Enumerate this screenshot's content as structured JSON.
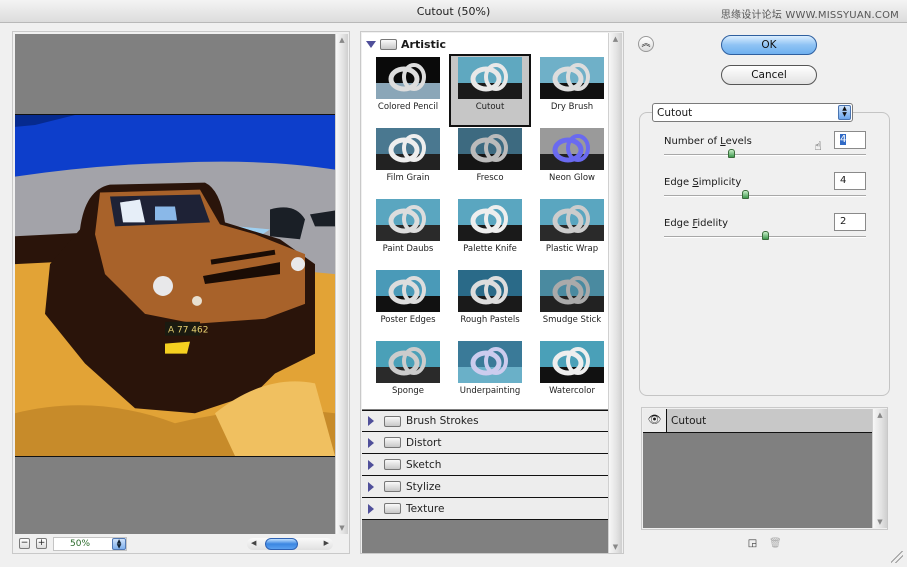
{
  "window": {
    "title": "Cutout (50%)",
    "watermark": "思缘设计论坛 WWW.MISSYUAN.COM"
  },
  "preview": {
    "zoom_out_label": "−",
    "zoom_in_label": "+",
    "zoom_value": "50%",
    "license_plate": "A 77 462"
  },
  "filter_gallery": {
    "open_category": "Artistic",
    "filters": [
      {
        "label": "Colored Pencil",
        "selected": false
      },
      {
        "label": "Cutout",
        "selected": true
      },
      {
        "label": "Dry Brush",
        "selected": false
      },
      {
        "label": "Film Grain",
        "selected": false
      },
      {
        "label": "Fresco",
        "selected": false
      },
      {
        "label": "Neon Glow",
        "selected": false
      },
      {
        "label": "Paint Daubs",
        "selected": false
      },
      {
        "label": "Palette Knife",
        "selected": false
      },
      {
        "label": "Plastic Wrap",
        "selected": false
      },
      {
        "label": "Poster Edges",
        "selected": false
      },
      {
        "label": "Rough Pastels",
        "selected": false
      },
      {
        "label": "Smudge Stick",
        "selected": false
      },
      {
        "label": "Sponge",
        "selected": false
      },
      {
        "label": "Underpainting",
        "selected": false
      },
      {
        "label": "Watercolor",
        "selected": false
      }
    ],
    "collapsed_categories": [
      "Brush Strokes",
      "Distort",
      "Sketch",
      "Stylize",
      "Texture"
    ]
  },
  "actions": {
    "ok_label": "OK",
    "cancel_label": "Cancel",
    "collapse_icon": "double-chevron-up"
  },
  "settings": {
    "selected_filter": "Cutout",
    "params": [
      {
        "label_pre": "Number of ",
        "label_key": "L",
        "label_post": "evels",
        "value": "4",
        "slider_fraction": 0.33,
        "focused": true
      },
      {
        "label_pre": "Edge ",
        "label_key": "S",
        "label_post": "implicity",
        "value": "4",
        "slider_fraction": 0.4,
        "focused": false
      },
      {
        "label_pre": "Edge ",
        "label_key": "F",
        "label_post": "idelity",
        "value": "2",
        "slider_fraction": 0.5,
        "focused": false
      }
    ]
  },
  "effect_layers": {
    "items": [
      {
        "name": "Cutout",
        "visible": true
      }
    ],
    "new_layer_icon": "new-effect-layer",
    "delete_icon": "trash"
  },
  "colors": {
    "accent_blue": "#3b86e2",
    "sky": "#0d3ecb",
    "ground": "#e2a336",
    "truck": "#a8622a"
  }
}
